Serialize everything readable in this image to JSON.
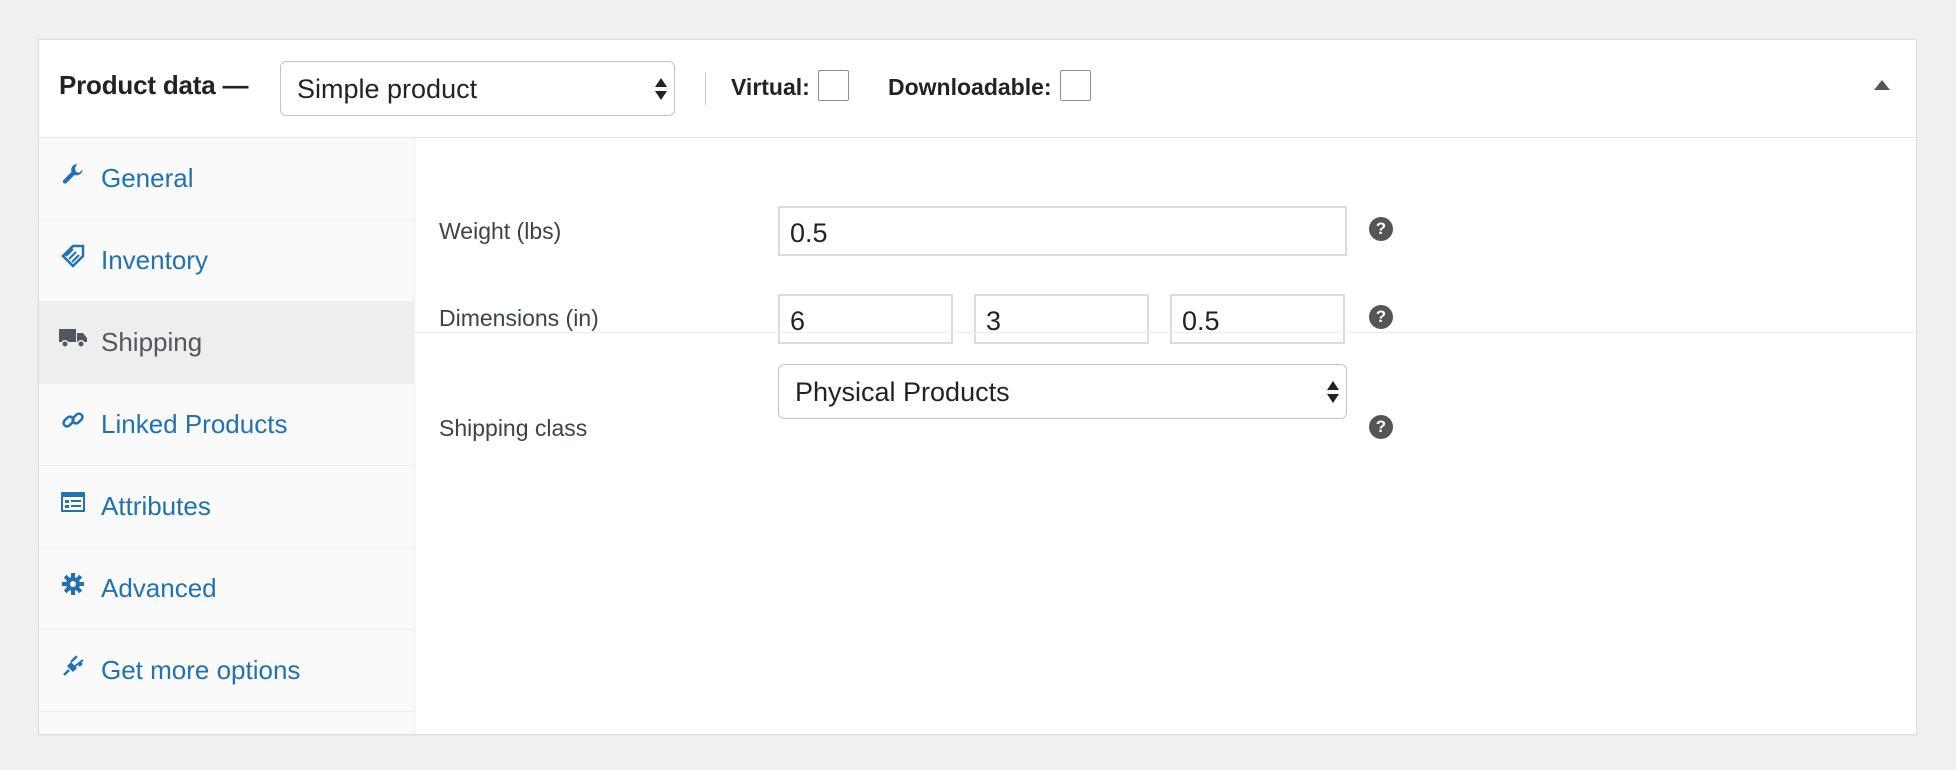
{
  "header": {
    "title": "Product data —",
    "product_type": "Simple product",
    "virtual_label": "Virtual:",
    "downloadable_label": "Downloadable:",
    "virtual_checked": false,
    "downloadable_checked": false
  },
  "tabs": [
    {
      "label": "General",
      "icon": "wrench-icon",
      "active": false
    },
    {
      "label": "Inventory",
      "icon": "tag-icon",
      "active": false
    },
    {
      "label": "Shipping",
      "icon": "truck-icon",
      "active": true
    },
    {
      "label": "Linked Products",
      "icon": "link-icon",
      "active": false
    },
    {
      "label": "Attributes",
      "icon": "list-card-icon",
      "active": false
    },
    {
      "label": "Advanced",
      "icon": "gear-icon",
      "active": false
    },
    {
      "label": "Get more options",
      "icon": "plug-icon",
      "active": false
    }
  ],
  "shipping": {
    "weight_label": "Weight (lbs)",
    "weight_value": "0.5",
    "dimensions_label": "Dimensions (in)",
    "length_value": "6",
    "width_value": "3",
    "height_value": "0.5",
    "class_label": "Shipping class",
    "class_value": "Physical Products",
    "help_glyph": "?"
  },
  "colors": {
    "link": "#2271b1",
    "active_tab_bg": "#eeeeee",
    "help_icon": "#555555"
  }
}
